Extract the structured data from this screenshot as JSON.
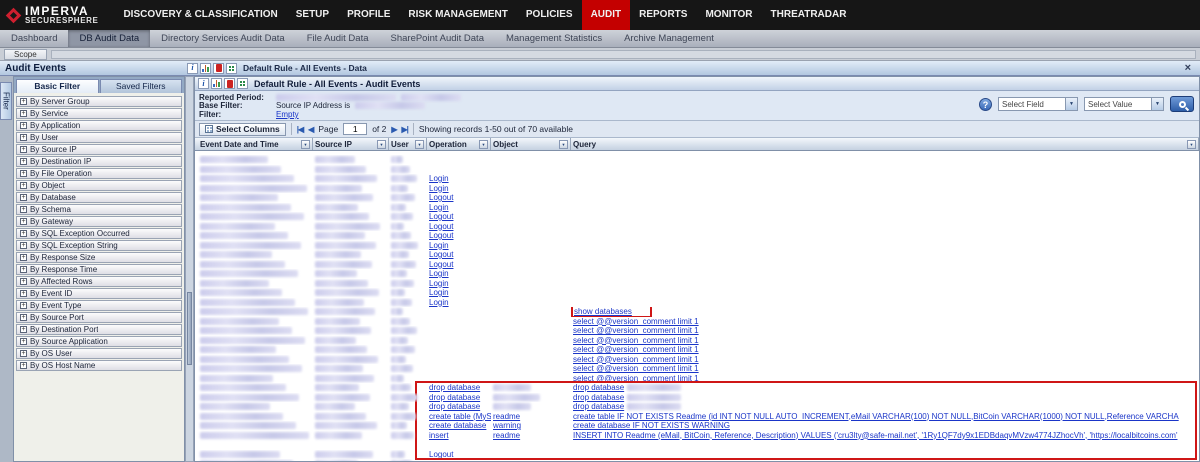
{
  "icons": {
    "expand": "+",
    "close": "×",
    "help": "?",
    "info": "i",
    "dropdown": "▼",
    "first_page": "|◀",
    "prev_page": "◀",
    "next_page": "▶",
    "last_page": "▶|"
  },
  "topnav": {
    "brand_line1": "IMPERVA",
    "brand_line2": "SECURESPHERE",
    "items": [
      {
        "label": "DISCOVERY & CLASSIFICATION",
        "active": false
      },
      {
        "label": "SETUP",
        "active": false
      },
      {
        "label": "PROFILE",
        "active": false
      },
      {
        "label": "RISK MANAGEMENT",
        "active": false
      },
      {
        "label": "POLICIES",
        "active": false
      },
      {
        "label": "AUDIT",
        "active": true
      },
      {
        "label": "REPORTS",
        "active": false
      },
      {
        "label": "MONITOR",
        "active": false
      },
      {
        "label": "THREATRADAR",
        "active": false
      }
    ]
  },
  "subnav": {
    "items": [
      {
        "label": "Dashboard",
        "active": false
      },
      {
        "label": "DB Audit Data",
        "active": true
      },
      {
        "label": "Directory Services Audit Data",
        "active": false
      },
      {
        "label": "File Audit Data",
        "active": false
      },
      {
        "label": "SharePoint Audit Data",
        "active": false
      },
      {
        "label": "Management Statistics",
        "active": false
      },
      {
        "label": "Archive Management",
        "active": false
      }
    ]
  },
  "scope_bar": {
    "label": "Scope"
  },
  "panel_bar": {
    "title": "Audit Events",
    "toolbar_title": "Default Rule - All Events - Data"
  },
  "filter_panel": {
    "side_tab": "Filter",
    "tabs": [
      {
        "label": "Basic Filter",
        "active": true
      },
      {
        "label": "Saved Filters",
        "active": false
      }
    ],
    "items": [
      "By Server Group",
      "By Service",
      "By Application",
      "By User",
      "By Source IP",
      "By Destination IP",
      "By File Operation",
      "By Object",
      "By Database",
      "By Schema",
      "By Gateway",
      "By SQL Exception Occurred",
      "By SQL Exception String",
      "By Response Size",
      "By Response Time",
      "By Affected Rows",
      "By Event ID",
      "By Event Type",
      "By Source Port",
      "By Destination Port",
      "By Source Application",
      "By OS User",
      "By OS Host Name"
    ]
  },
  "main": {
    "header": {
      "title": "Default Rule - All Events - Audit Events"
    },
    "info": {
      "reported_period_label": "Reported Period:",
      "base_filter_label": "Base Filter:",
      "base_filter_value": "Source IP Address is",
      "filter_label": "Filter:",
      "filter_value": "Empty"
    },
    "finder": {
      "field_select": "Select Field",
      "value_select": "Select Value"
    },
    "grid_toolbar": {
      "select_columns": "Select Columns",
      "page_label": "Page",
      "page_value": "1",
      "total_pages": "of 2",
      "records_summary": "Showing records 1-50 out of 70 available"
    },
    "table": {
      "columns": [
        {
          "label": "Event Date and Time"
        },
        {
          "label": "Source IP"
        },
        {
          "label": "User"
        },
        {
          "label": "Operation"
        },
        {
          "label": "Object"
        },
        {
          "label": "Query"
        }
      ],
      "rows": [
        {},
        {},
        {
          "op": "Login"
        },
        {
          "op": "Login"
        },
        {
          "op": "Logout"
        },
        {
          "op": "Login"
        },
        {
          "op": "Logout"
        },
        {
          "op": "Logout"
        },
        {
          "op": "Logout"
        },
        {
          "op": "Login"
        },
        {
          "op": "Logout"
        },
        {
          "op": "Logout"
        },
        {
          "op": "Login"
        },
        {
          "op": "Login"
        },
        {
          "op": "Login"
        },
        {
          "op": "Login"
        },
        {
          "query": "show databases",
          "query_boxed": true
        },
        {
          "query": "select @@version_comment limit 1"
        },
        {
          "query": "select @@version_comment limit 1"
        },
        {
          "query": "select @@version_comment limit 1"
        },
        {
          "query": "select @@version_comment limit 1"
        },
        {
          "query": "select @@version_comment limit 1"
        },
        {
          "query": "select @@version_comment limit 1"
        },
        {
          "query": "select @@version_comment limit 1"
        },
        {
          "op": "drop database",
          "obj_redacted": true,
          "query": "drop database",
          "query_redacted_tail": true
        },
        {
          "op": "drop database",
          "obj_redacted": true,
          "query": "drop database",
          "query_redacted_tail": true
        },
        {
          "op": "drop database",
          "obj_redacted": true,
          "query": "drop database",
          "query_redacted_tail": true
        },
        {
          "op": "create table (MySQL)",
          "obj": "readme",
          "query": "create table IF NOT EXISTS Readme (id INT NOT NULL AUTO_INCREMENT,eMail VARCHAR(100) NOT NULL,BitCoin VARCHAR(1000) NOT NULL,Reference VARCHA"
        },
        {
          "op": "create database",
          "obj": "warning",
          "query": "create database IF NOT EXISTS WARNING"
        },
        {
          "op": "insert",
          "obj": "readme",
          "two_line": true,
          "query": "INSERT INTO Readme (eMail, BitCoin, Reference, Description) VALUES ('cru3lty@safe-mail.net', '1Ry1QF7dy9x1EDBdaqvMVzw4774JZhocVh', 'https://localbitcoins.com'"
        },
        {
          "op": "Logout"
        },
        {}
      ]
    }
  }
}
